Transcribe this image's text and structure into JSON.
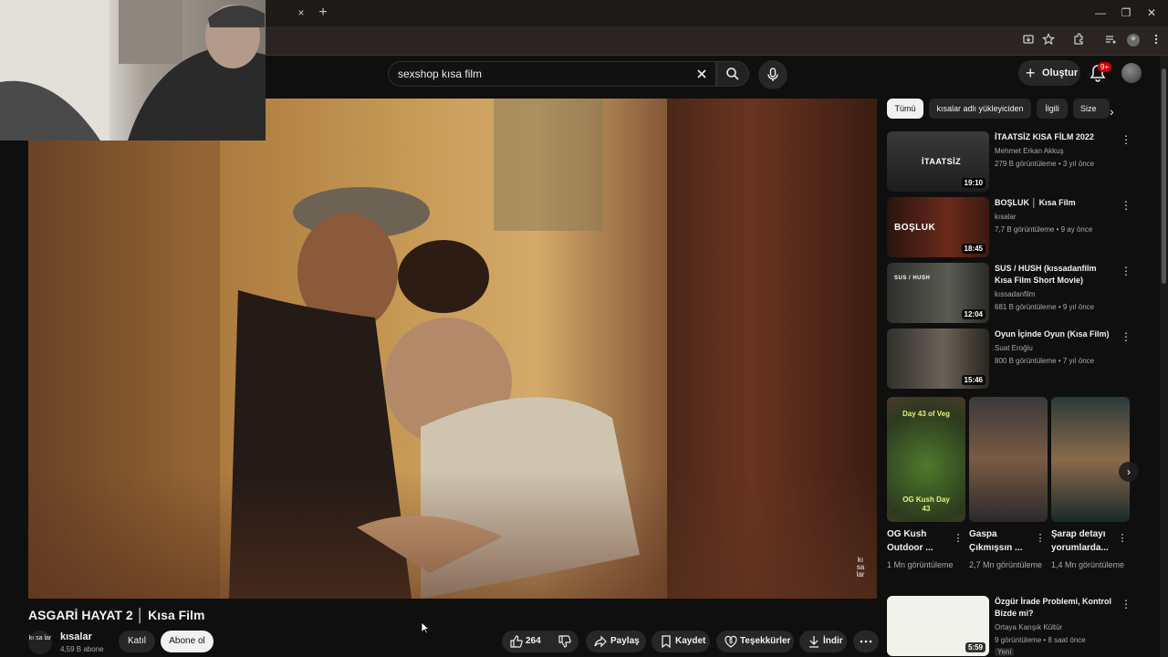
{
  "browser": {
    "tab_close_glyph": "×",
    "new_tab_glyph": "+",
    "window_controls": [
      "—",
      "❐",
      "✕"
    ]
  },
  "header": {
    "search_query": "sexshop kısa film",
    "create_label": "Oluştur",
    "notification_count": "9+"
  },
  "video": {
    "watermark": "kı sa lar",
    "title": "ASGARİ HAYAT 2 │ Kısa Film",
    "channel": {
      "avatar_text": "kı sa lar",
      "name": "kısalar",
      "subscribers": "4,59 B abone"
    },
    "join_label": "Katıl",
    "subscribe_label": "Abone ol",
    "like_count": "264",
    "share_label": "Paylaş",
    "save_label": "Kaydet",
    "thanks_label": "Teşekkürler",
    "download_label": "İndir"
  },
  "sidebar": {
    "chips": [
      "Tümü",
      "kısalar adlı yükleyiciden",
      "İlgili",
      "Size"
    ],
    "recommendations": [
      {
        "title": "İTAATSİZ KISA FİLM 2022",
        "channel": "Mehmet Erkan Akkuş",
        "stats": "279 B görüntüleme • 3 yıl önce",
        "duration": "19:10",
        "thumb_text": "İTAATSİZ"
      },
      {
        "title": "BOŞLUK │ Kısa Film",
        "channel": "kısalar",
        "stats": "7,7 B görüntüleme • 9 ay önce",
        "duration": "18:45",
        "thumb_text": "BOŞLUK"
      },
      {
        "title": "SUS / HUSH (kıssadanfilm Kısa Film Short Movie)",
        "channel": "kıssadanfilm",
        "stats": "681 B görüntüleme • 9 yıl önce",
        "duration": "12:04",
        "thumb_text": "SUS / HUSH"
      },
      {
        "title": "Oyun İçinde Oyun (Kısa Film)",
        "channel": "Suat Eroğlu",
        "stats": "800 B görüntüleme • 7 yıl önce",
        "duration": "15:46",
        "thumb_text": ""
      },
      {
        "title": "Özgür İrade Problemi, Kontrol Bizde mi?",
        "channel": "Ortaya Karışık Kültür",
        "stats": "9 görüntüleme • 8 saat önce",
        "duration": "5:59",
        "thumb_text": "",
        "badge": "Yeni"
      }
    ],
    "shorts": [
      {
        "title": "OG Kush Outdoor ...",
        "views": "1 Mn görüntüleme",
        "overlay_top": "Day 43 of Veg",
        "overlay_bottom": "OG Kush Day 43"
      },
      {
        "title": "Gaspa Çıkmışsın ...",
        "views": "2,7 Mn görüntüleme",
        "overlay_top": "",
        "overlay_bottom": ""
      },
      {
        "title": "Şarap detayı yorumlarda...",
        "views": "1,4 Mn görüntüleme",
        "overlay_top": "",
        "overlay_bottom": ""
      }
    ]
  },
  "colors": {
    "background": "#0f0f0f",
    "notification_badge": "#cc0000",
    "subscribe_button": "#f1f1f1"
  },
  "icons": [
    "close-icon",
    "plus-icon",
    "search-icon",
    "mic-icon",
    "bell-icon",
    "like-icon",
    "dislike-icon",
    "share-icon",
    "save-icon",
    "thanks-icon",
    "download-icon",
    "more-icon",
    "chevron-right-icon"
  ]
}
